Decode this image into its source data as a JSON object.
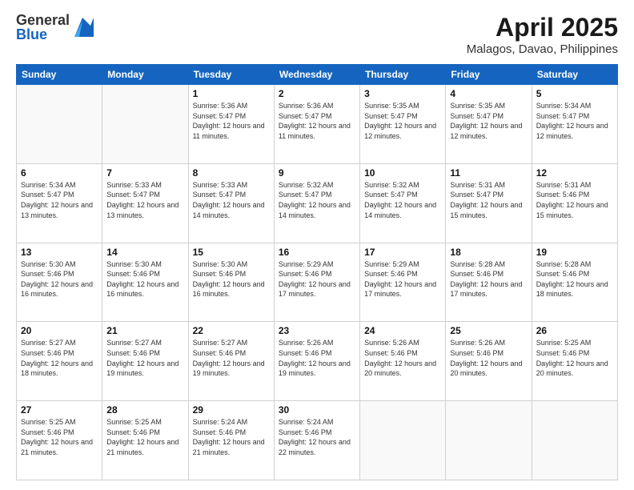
{
  "logo": {
    "general": "General",
    "blue": "Blue"
  },
  "title": "April 2025",
  "subtitle": "Malagos, Davao, Philippines",
  "days_of_week": [
    "Sunday",
    "Monday",
    "Tuesday",
    "Wednesday",
    "Thursday",
    "Friday",
    "Saturday"
  ],
  "weeks": [
    [
      {
        "day": "",
        "info": ""
      },
      {
        "day": "",
        "info": ""
      },
      {
        "day": "1",
        "info": "Sunrise: 5:36 AM\nSunset: 5:47 PM\nDaylight: 12 hours and 11 minutes."
      },
      {
        "day": "2",
        "info": "Sunrise: 5:36 AM\nSunset: 5:47 PM\nDaylight: 12 hours and 11 minutes."
      },
      {
        "day": "3",
        "info": "Sunrise: 5:35 AM\nSunset: 5:47 PM\nDaylight: 12 hours and 12 minutes."
      },
      {
        "day": "4",
        "info": "Sunrise: 5:35 AM\nSunset: 5:47 PM\nDaylight: 12 hours and 12 minutes."
      },
      {
        "day": "5",
        "info": "Sunrise: 5:34 AM\nSunset: 5:47 PM\nDaylight: 12 hours and 12 minutes."
      }
    ],
    [
      {
        "day": "6",
        "info": "Sunrise: 5:34 AM\nSunset: 5:47 PM\nDaylight: 12 hours and 13 minutes."
      },
      {
        "day": "7",
        "info": "Sunrise: 5:33 AM\nSunset: 5:47 PM\nDaylight: 12 hours and 13 minutes."
      },
      {
        "day": "8",
        "info": "Sunrise: 5:33 AM\nSunset: 5:47 PM\nDaylight: 12 hours and 14 minutes."
      },
      {
        "day": "9",
        "info": "Sunrise: 5:32 AM\nSunset: 5:47 PM\nDaylight: 12 hours and 14 minutes."
      },
      {
        "day": "10",
        "info": "Sunrise: 5:32 AM\nSunset: 5:47 PM\nDaylight: 12 hours and 14 minutes."
      },
      {
        "day": "11",
        "info": "Sunrise: 5:31 AM\nSunset: 5:47 PM\nDaylight: 12 hours and 15 minutes."
      },
      {
        "day": "12",
        "info": "Sunrise: 5:31 AM\nSunset: 5:46 PM\nDaylight: 12 hours and 15 minutes."
      }
    ],
    [
      {
        "day": "13",
        "info": "Sunrise: 5:30 AM\nSunset: 5:46 PM\nDaylight: 12 hours and 16 minutes."
      },
      {
        "day": "14",
        "info": "Sunrise: 5:30 AM\nSunset: 5:46 PM\nDaylight: 12 hours and 16 minutes."
      },
      {
        "day": "15",
        "info": "Sunrise: 5:30 AM\nSunset: 5:46 PM\nDaylight: 12 hours and 16 minutes."
      },
      {
        "day": "16",
        "info": "Sunrise: 5:29 AM\nSunset: 5:46 PM\nDaylight: 12 hours and 17 minutes."
      },
      {
        "day": "17",
        "info": "Sunrise: 5:29 AM\nSunset: 5:46 PM\nDaylight: 12 hours and 17 minutes."
      },
      {
        "day": "18",
        "info": "Sunrise: 5:28 AM\nSunset: 5:46 PM\nDaylight: 12 hours and 17 minutes."
      },
      {
        "day": "19",
        "info": "Sunrise: 5:28 AM\nSunset: 5:46 PM\nDaylight: 12 hours and 18 minutes."
      }
    ],
    [
      {
        "day": "20",
        "info": "Sunrise: 5:27 AM\nSunset: 5:46 PM\nDaylight: 12 hours and 18 minutes."
      },
      {
        "day": "21",
        "info": "Sunrise: 5:27 AM\nSunset: 5:46 PM\nDaylight: 12 hours and 19 minutes."
      },
      {
        "day": "22",
        "info": "Sunrise: 5:27 AM\nSunset: 5:46 PM\nDaylight: 12 hours and 19 minutes."
      },
      {
        "day": "23",
        "info": "Sunrise: 5:26 AM\nSunset: 5:46 PM\nDaylight: 12 hours and 19 minutes."
      },
      {
        "day": "24",
        "info": "Sunrise: 5:26 AM\nSunset: 5:46 PM\nDaylight: 12 hours and 20 minutes."
      },
      {
        "day": "25",
        "info": "Sunrise: 5:26 AM\nSunset: 5:46 PM\nDaylight: 12 hours and 20 minutes."
      },
      {
        "day": "26",
        "info": "Sunrise: 5:25 AM\nSunset: 5:46 PM\nDaylight: 12 hours and 20 minutes."
      }
    ],
    [
      {
        "day": "27",
        "info": "Sunrise: 5:25 AM\nSunset: 5:46 PM\nDaylight: 12 hours and 21 minutes."
      },
      {
        "day": "28",
        "info": "Sunrise: 5:25 AM\nSunset: 5:46 PM\nDaylight: 12 hours and 21 minutes."
      },
      {
        "day": "29",
        "info": "Sunrise: 5:24 AM\nSunset: 5:46 PM\nDaylight: 12 hours and 21 minutes."
      },
      {
        "day": "30",
        "info": "Sunrise: 5:24 AM\nSunset: 5:46 PM\nDaylight: 12 hours and 22 minutes."
      },
      {
        "day": "",
        "info": ""
      },
      {
        "day": "",
        "info": ""
      },
      {
        "day": "",
        "info": ""
      }
    ]
  ]
}
